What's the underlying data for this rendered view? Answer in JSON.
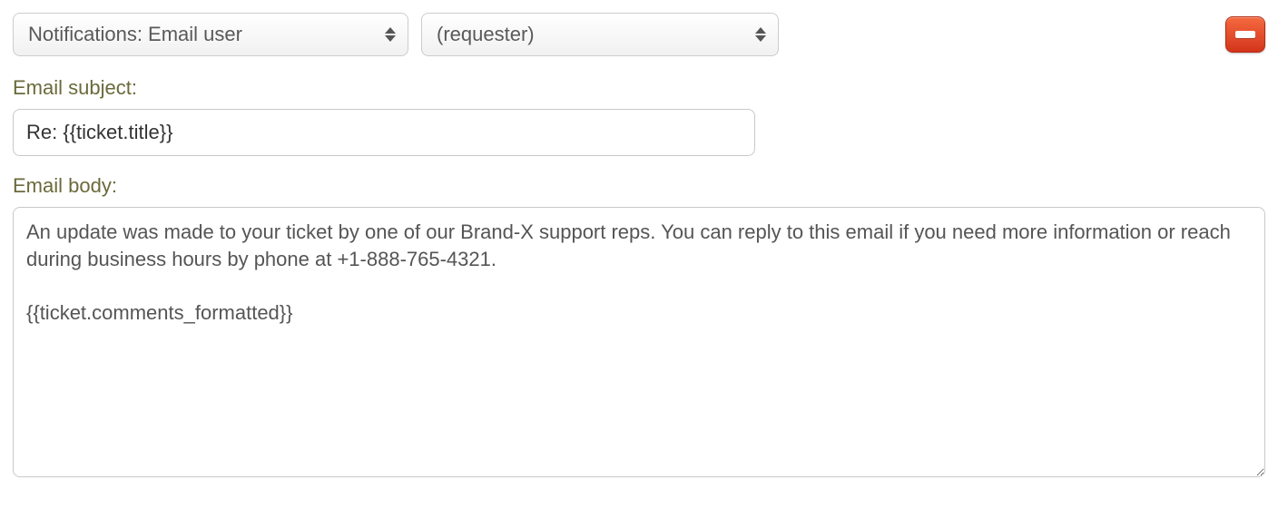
{
  "action": {
    "type_select": {
      "selected": "Notifications: Email user"
    },
    "target_select": {
      "selected": "(requester)"
    }
  },
  "labels": {
    "email_subject": "Email subject:",
    "email_body": "Email body:"
  },
  "fields": {
    "email_subject_value": "Re: {{ticket.title}}",
    "email_body_value": "An update was made to your ticket by one of our Brand-X support reps. You can reply to this email if you need more information or reach during business hours by phone at +1-888-765-4321.\n\n{{ticket.comments_formatted}}"
  }
}
